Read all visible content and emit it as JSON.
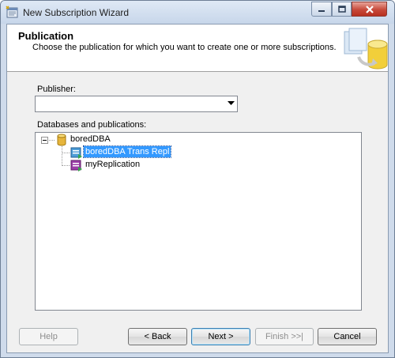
{
  "window": {
    "title": "New Subscription Wizard"
  },
  "header": {
    "title": "Publication",
    "subtitle": "Choose the publication for which you want to create one or more subscriptions."
  },
  "publisher": {
    "label": "Publisher:",
    "value": ""
  },
  "tree": {
    "label": "Databases and publications:",
    "root": {
      "label": "boredDBA",
      "icon": "database-icon",
      "expanded": true
    },
    "children": [
      {
        "label": "boredDBA Trans Repl",
        "icon": "transactional-publication-icon",
        "selected": true
      },
      {
        "label": "myReplication",
        "icon": "merge-publication-icon",
        "selected": false
      }
    ]
  },
  "buttons": {
    "help": "Help",
    "back": "< Back",
    "next": "Next >",
    "finish": "Finish >>|",
    "cancel": "Cancel"
  },
  "colors": {
    "selection": "#3399ff",
    "close_button": "#c7493a",
    "frame": "#cfdbeb"
  }
}
